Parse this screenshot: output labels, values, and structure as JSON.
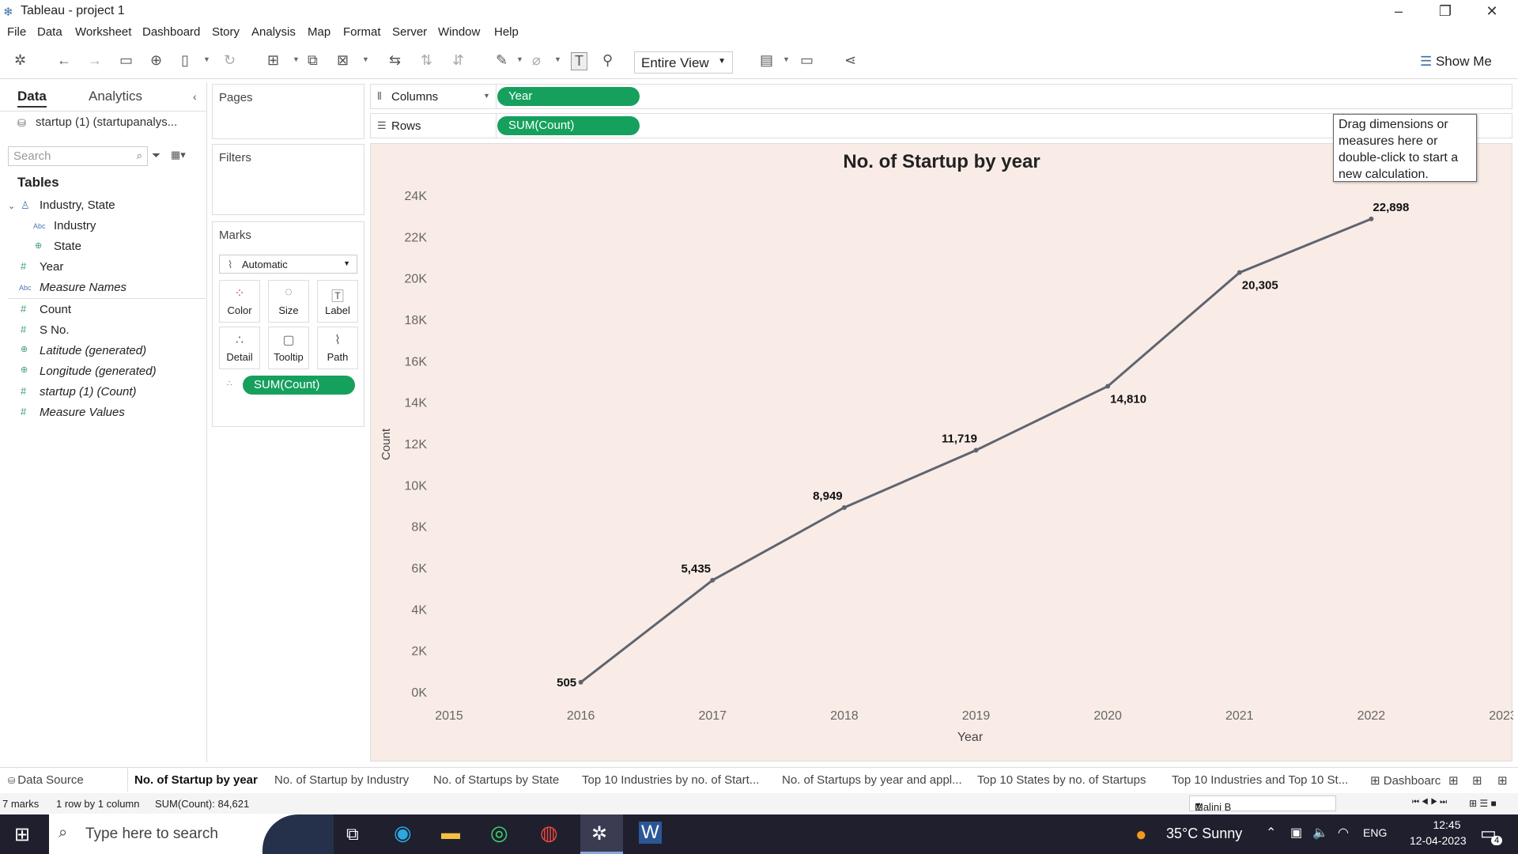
{
  "window": {
    "title": "Tableau - project 1"
  },
  "menu": [
    "File",
    "Data",
    "Worksheet",
    "Dashboard",
    "Story",
    "Analysis",
    "Map",
    "Format",
    "Server",
    "Window",
    "Help"
  ],
  "toolbar": {
    "fit": "Entire View",
    "show_me": "Show Me"
  },
  "data_pane": {
    "tabs": [
      "Data",
      "Analytics"
    ],
    "datasource": "startup (1) (startupanalys...",
    "search_placeholder": "Search",
    "tables_heading": "Tables",
    "fields": [
      {
        "name": "Industry, State",
        "icon": "hierarchy-icon"
      },
      {
        "name": "Industry",
        "icon": "abc-icon"
      },
      {
        "name": "State",
        "icon": "globe-icon"
      },
      {
        "name": "Year",
        "icon": "hash-icon"
      },
      {
        "name": "Measure Names",
        "icon": "abc-icon"
      },
      {
        "name": "Count",
        "icon": "hash-icon"
      },
      {
        "name": "S No.",
        "icon": "hash-icon"
      },
      {
        "name": "Latitude (generated)",
        "icon": "globe-icon"
      },
      {
        "name": "Longitude (generated)",
        "icon": "globe-icon"
      },
      {
        "name": "startup (1) (Count)",
        "icon": "hash-icon"
      },
      {
        "name": "Measure Values",
        "icon": "hash-icon"
      }
    ]
  },
  "cards": {
    "pages": "Pages",
    "filters": "Filters",
    "marks": "Marks",
    "mark_type": "Automatic",
    "mark_buttons": [
      "Color",
      "Size",
      "Label",
      "Detail",
      "Tooltip",
      "Path"
    ],
    "mark_pill": "SUM(Count)"
  },
  "shelves": {
    "columns_label": "Columns",
    "columns_pill": "Year",
    "rows_label": "Rows",
    "rows_pill": "SUM(Count)"
  },
  "tooltip": "Drag dimensions or measures here or double-click to start a new calculation.",
  "chart_data": {
    "type": "line",
    "title": "No. of Startup by year",
    "xlabel": "Year",
    "ylabel": "Count",
    "x": [
      2016,
      2017,
      2018,
      2019,
      2020,
      2021,
      2022
    ],
    "values": [
      505,
      5435,
      8949,
      11719,
      14810,
      20305,
      22898
    ],
    "data_labels": [
      "505",
      "5,435",
      "8,949",
      "11,719",
      "14,810",
      "20,305",
      "22,898"
    ],
    "x_ticks": [
      "2015",
      "2016",
      "2017",
      "2018",
      "2019",
      "2020",
      "2021",
      "2022",
      "2023"
    ],
    "y_ticks": [
      "0K",
      "2K",
      "4K",
      "6K",
      "8K",
      "10K",
      "12K",
      "14K",
      "16K",
      "18K",
      "20K",
      "22K",
      "24K"
    ],
    "xlim": [
      2015,
      2023
    ],
    "ylim": [
      0,
      24000
    ],
    "line_color": "#5f6470",
    "background": "#f9ece6"
  },
  "sheet_tabs": [
    "Data Source",
    "No. of Startup by year",
    "No. of Startup by Industry",
    "No. of Startups by State",
    "Top 10 Industries by no. of Start...",
    "No. of Startups by year and appl...",
    "Top 10 States by no. of Startups",
    "Top 10 Industries and Top 10 St...",
    "Dashboarc"
  ],
  "status": {
    "marks": "7 marks",
    "rows": "1 row by 1 column",
    "sum": "SUM(Count): 84,621",
    "user": "Malini B"
  },
  "taskbar": {
    "search": "Type here to search",
    "weather": "35°C  Sunny",
    "lang": "ENG",
    "time": "12:45",
    "date": "12-04-2023",
    "notif": "4"
  }
}
